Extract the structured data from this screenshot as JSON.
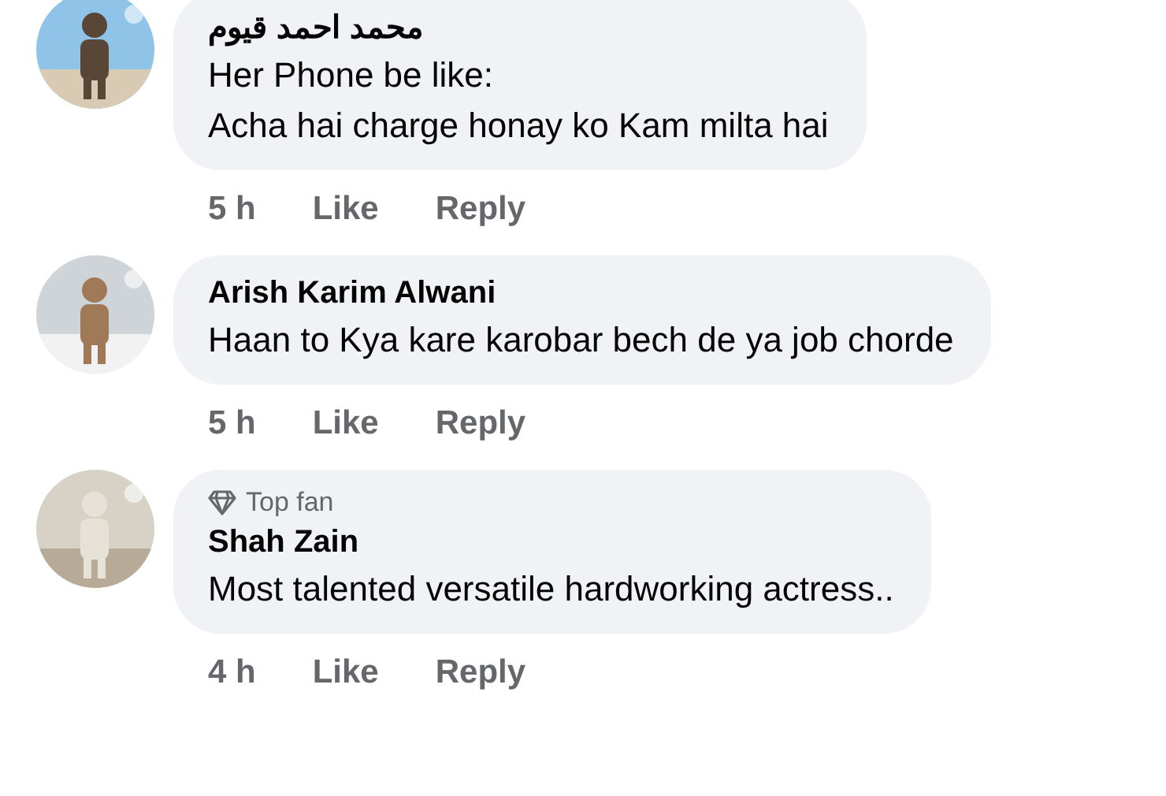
{
  "comments": [
    {
      "author": "محمد احمد قیوم",
      "text": "Her Phone be like:\nAcha hai charge honay ko Kam milta hai",
      "time": "5 h",
      "actions": [
        "Like",
        "Reply"
      ]
    },
    {
      "author": "Arish Karim Alwani",
      "text": "Haan to Kya kare karobar bech de ya job chorde",
      "time": "5 h",
      "actions": [
        "Like",
        "Reply"
      ]
    },
    {
      "badge": "Top fan",
      "author": "Shah Zain",
      "text": "Most talented versatile hardworking actress..",
      "time": "4 h",
      "actions": [
        "Like",
        "Reply"
      ]
    }
  ]
}
